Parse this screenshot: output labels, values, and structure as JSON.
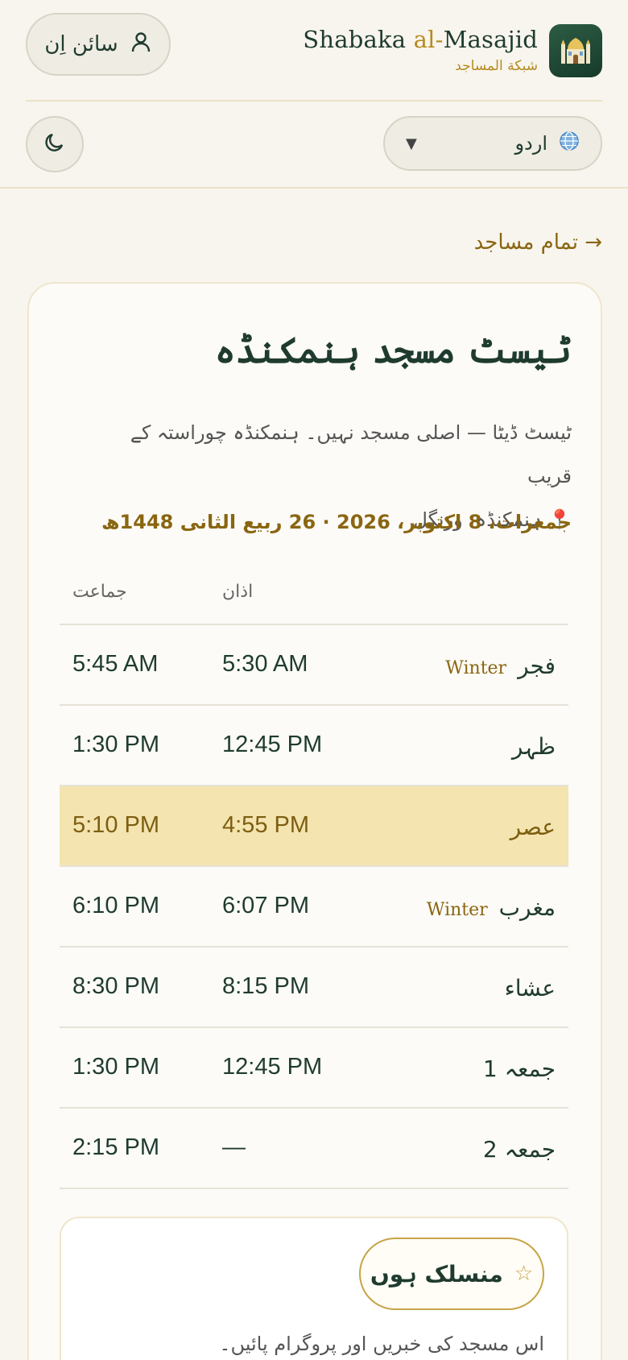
{
  "header": {
    "brand_prefix": "Shabaka ",
    "brand_al": "al-",
    "brand_suffix": "Masajid",
    "brand_subtitle": "شبکة المساجد",
    "signin_label": "سائن اِن",
    "language_selected": "اردو",
    "icons": {
      "user": "user-icon",
      "globe": "globe-icon",
      "theme": "moon-icon",
      "logo": "mosque-icon"
    }
  },
  "nav": {
    "back_link": "→ تمام مساجد"
  },
  "mosque": {
    "name": "ٹیسٹ مسجد ہنمکنڈہ",
    "description": "ٹیسٹ ڈیٹا — اصلی مسجد نہیں۔ ہنمکنڈہ چوراستہ کے قریب",
    "location_pin": "📍",
    "location": "ہنمکنڈہ، ورنگل",
    "date_line": "جمعرات، 8 اکتوبر، 2026 · 26 ربیع الثانی 1448ھ"
  },
  "timetable": {
    "col_jamaat": "جماعت",
    "col_adhan": "اذان",
    "rows": [
      {
        "prayer": "فجر",
        "season": "Winter",
        "adhan": "5:30 AM",
        "jamaat": "5:45 AM",
        "active": false
      },
      {
        "prayer": "ظہر",
        "season": "",
        "adhan": "12:45 PM",
        "jamaat": "1:30 PM",
        "active": false
      },
      {
        "prayer": "عصر",
        "season": "",
        "adhan": "4:55 PM",
        "jamaat": "5:10 PM",
        "active": true
      },
      {
        "prayer": "مغرب",
        "season": "Winter",
        "adhan": "6:07 PM",
        "jamaat": "6:10 PM",
        "active": false
      },
      {
        "prayer": "عشاء",
        "season": "",
        "adhan": "8:15 PM",
        "jamaat": "8:30 PM",
        "active": false
      },
      {
        "prayer": "جمعہ 1",
        "season": "",
        "adhan": "12:45 PM",
        "jamaat": "1:30 PM",
        "active": false
      },
      {
        "prayer": "جمعہ 2",
        "season": "",
        "adhan": "—",
        "jamaat": "2:15 PM",
        "active": false
      }
    ]
  },
  "follow": {
    "star": "☆",
    "button_label": "منسلک ہوں",
    "note": "اس مسجد کی خبریں اور پروگرام پائیں۔"
  },
  "colors": {
    "background": "#f8f5ee",
    "primary": "#1f3b2f",
    "accent": "#b58a1f",
    "active_row": "#f3e4b0"
  }
}
